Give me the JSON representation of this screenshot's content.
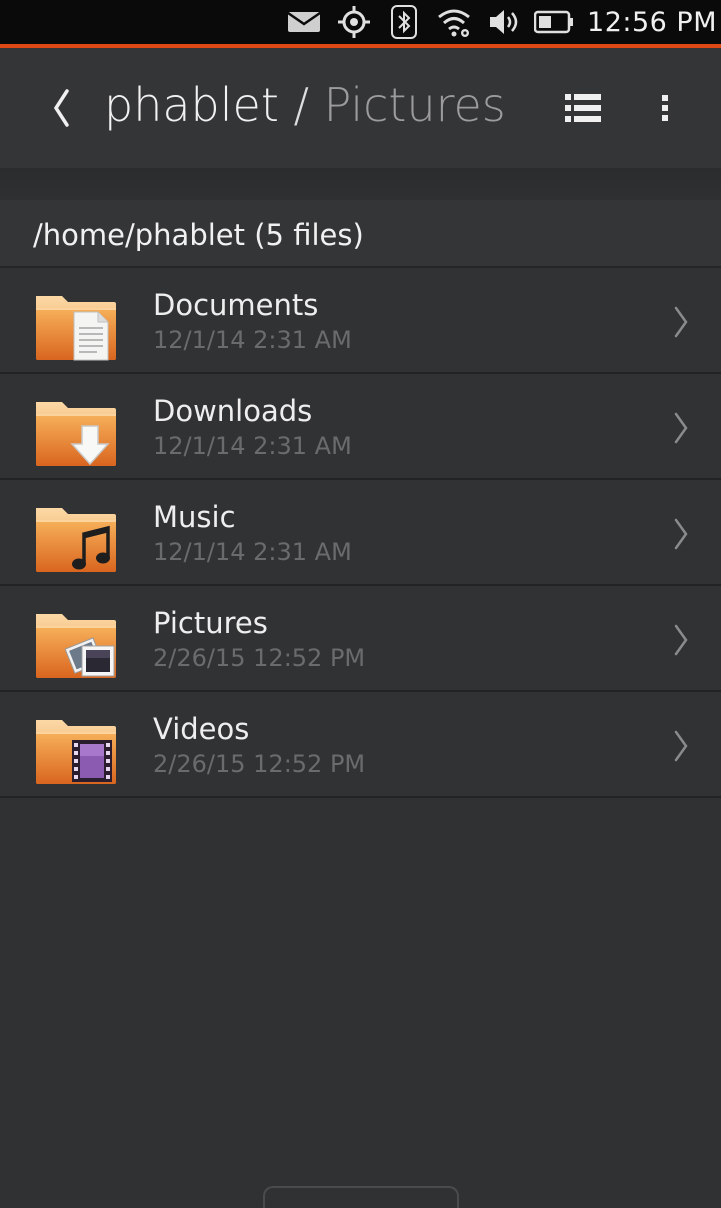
{
  "status_bar": {
    "time": "12:56 PM",
    "icons": [
      "mail-icon",
      "location-icon",
      "bluetooth-icon",
      "wifi-icon",
      "volume-icon",
      "battery-icon"
    ],
    "accent_color": "#dd4814"
  },
  "header": {
    "crumb_root": "phablet",
    "separator": " / ",
    "crumb_current": "Pictures"
  },
  "path_bar": {
    "text": "/home/phablet (5 files)"
  },
  "files": [
    {
      "name": "Documents",
      "date": "12/1/14 2:31 AM",
      "icon": "documents-folder-icon"
    },
    {
      "name": "Downloads",
      "date": "12/1/14 2:31 AM",
      "icon": "downloads-folder-icon"
    },
    {
      "name": "Music",
      "date": "12/1/14 2:31 AM",
      "icon": "music-folder-icon"
    },
    {
      "name": "Pictures",
      "date": "2/26/15 12:52 PM",
      "icon": "pictures-folder-icon"
    },
    {
      "name": "Videos",
      "date": "2/26/15 12:52 PM",
      "icon": "videos-folder-icon"
    }
  ]
}
